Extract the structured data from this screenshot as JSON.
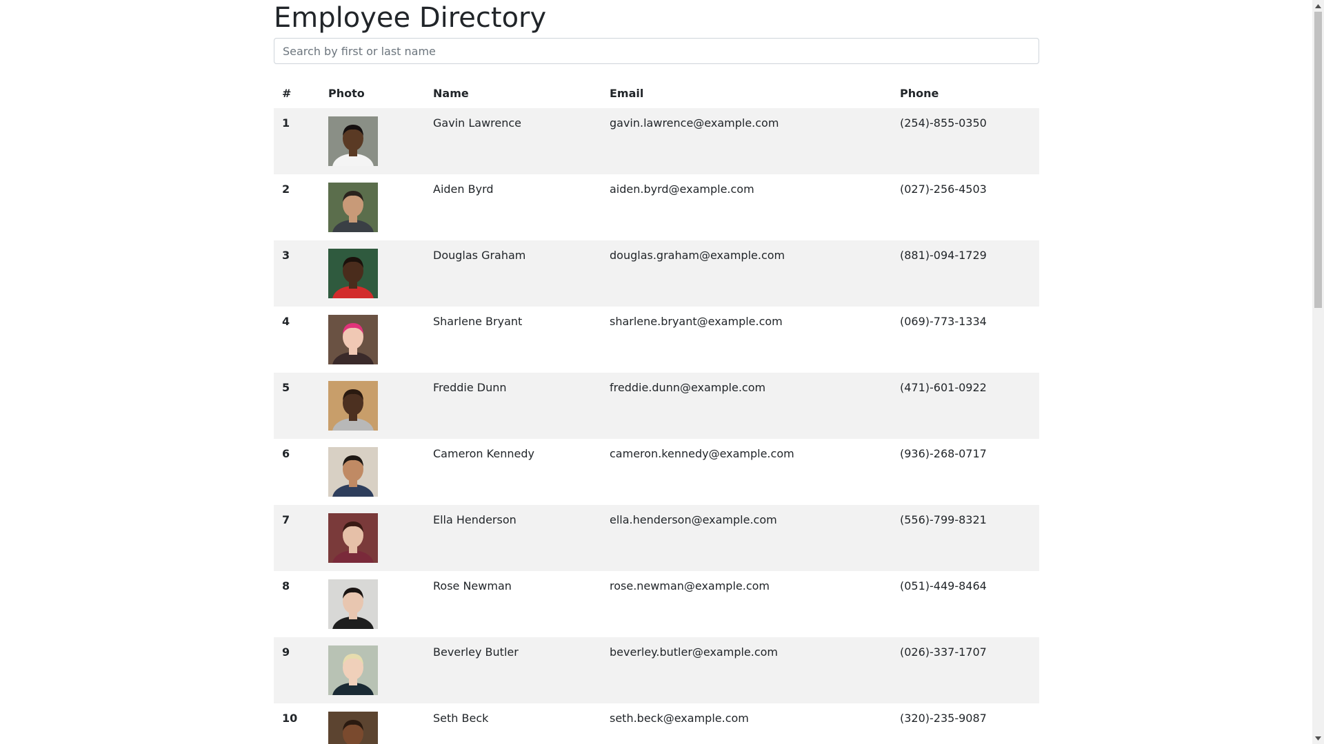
{
  "header": {
    "title": "Employee Directory"
  },
  "search": {
    "placeholder": "Search by first or last name",
    "value": ""
  },
  "table": {
    "columns": [
      "#",
      "Photo",
      "Name",
      "Email",
      "Phone"
    ],
    "rows": [
      {
        "num": "1",
        "name": "Gavin Lawrence",
        "email": "gavin.lawrence@example.com",
        "phone": "(254)-855-0350",
        "photo": "portrait-photo"
      },
      {
        "num": "2",
        "name": "Aiden Byrd",
        "email": "aiden.byrd@example.com",
        "phone": "(027)-256-4503",
        "photo": "portrait-photo"
      },
      {
        "num": "3",
        "name": "Douglas Graham",
        "email": "douglas.graham@example.com",
        "phone": "(881)-094-1729",
        "photo": "portrait-photo"
      },
      {
        "num": "4",
        "name": "Sharlene Bryant",
        "email": "sharlene.bryant@example.com",
        "phone": "(069)-773-1334",
        "photo": "portrait-photo"
      },
      {
        "num": "5",
        "name": "Freddie Dunn",
        "email": "freddie.dunn@example.com",
        "phone": "(471)-601-0922",
        "photo": "portrait-photo"
      },
      {
        "num": "6",
        "name": "Cameron Kennedy",
        "email": "cameron.kennedy@example.com",
        "phone": "(936)-268-0717",
        "photo": "portrait-photo"
      },
      {
        "num": "7",
        "name": "Ella Henderson",
        "email": "ella.henderson@example.com",
        "phone": "(556)-799-8321",
        "photo": "portrait-photo"
      },
      {
        "num": "8",
        "name": "Rose Newman",
        "email": "rose.newman@example.com",
        "phone": "(051)-449-8464",
        "photo": "portrait-photo"
      },
      {
        "num": "9",
        "name": "Beverley Butler",
        "email": "beverley.butler@example.com",
        "phone": "(026)-337-1707",
        "photo": "portrait-photo"
      },
      {
        "num": "10",
        "name": "Seth Beck",
        "email": "seth.beck@example.com",
        "phone": "(320)-235-9087",
        "photo": "portrait-photo"
      }
    ]
  },
  "colors": {
    "stripe": "#f2f2f2",
    "text": "#212529",
    "border": "#ced4da"
  }
}
